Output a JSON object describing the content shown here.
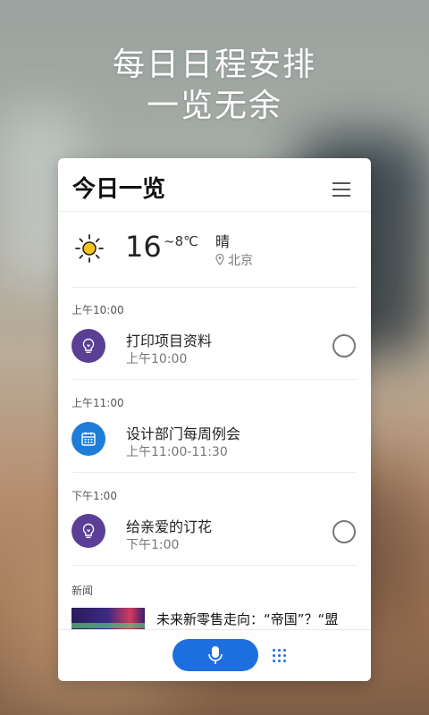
{
  "headline": {
    "line1": "每日日程安排",
    "line2": "一览无余"
  },
  "card": {
    "title": "今日一览",
    "menu_icon": "hamburger-menu-icon"
  },
  "weather": {
    "icon": "sun-icon",
    "temperature": "16",
    "temp_low": "~8℃",
    "condition": "晴",
    "city": "北京",
    "city_icon": "location-pin-icon"
  },
  "events": [
    {
      "time_header": "上午10:00",
      "title": "打印项目资料",
      "subtitle": "上午10:00",
      "icon": "lightbulb-icon",
      "icon_color": "#5b3f95",
      "has_checkbox": true
    },
    {
      "time_header": "上午11:00",
      "title": "设计部门每周例会",
      "subtitle": "上午11:00-11:30",
      "icon": "calendar-icon",
      "icon_color": "#1e7dd8",
      "has_checkbox": false
    },
    {
      "time_header": "下午1:00",
      "title": "给亲爱的订花",
      "subtitle": "下午1:00",
      "icon": "lightbulb-icon",
      "icon_color": "#5b3f95",
      "has_checkbox": true
    }
  ],
  "news": {
    "label": "新闻",
    "title": "未来新零售走向：“帝国”？“盟"
  },
  "bottom_bar": {
    "voice_button_icon": "microphone-icon",
    "voice_button_color": "#1d6fe0",
    "more_icon": "grid-dots-icon"
  }
}
